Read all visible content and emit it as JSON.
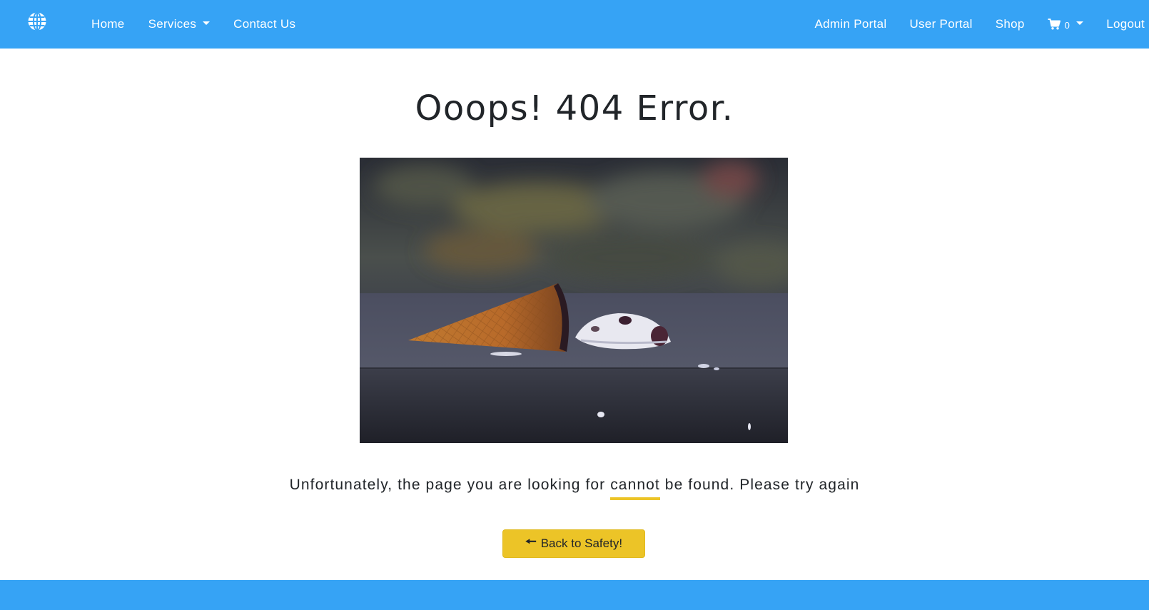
{
  "colors": {
    "navbar": "#36a3f5",
    "accent": "#ecc427",
    "text": "#212529"
  },
  "navbar": {
    "brand_icon": "globe-icon",
    "left_links": [
      {
        "label": "Home"
      },
      {
        "label": "Services",
        "dropdown": true
      },
      {
        "label": "Contact Us"
      }
    ],
    "right_links": [
      {
        "label": "Admin Portal"
      },
      {
        "label": "User Portal"
      },
      {
        "label": "Shop"
      }
    ],
    "cart": {
      "icon": "shopping-cart-icon",
      "count": "0"
    },
    "logout_label": "Logout"
  },
  "main": {
    "title": "Ooops! 404 Error.",
    "image_description_icon": "dropped-ice-cream-image",
    "message_before": "Unfortunately, the page you are looking for ",
    "message_highlight": "cannot",
    "message_after": " be found. Please try again",
    "button_label": "Back to Safety!",
    "button_icon": "arrow-left-icon"
  }
}
